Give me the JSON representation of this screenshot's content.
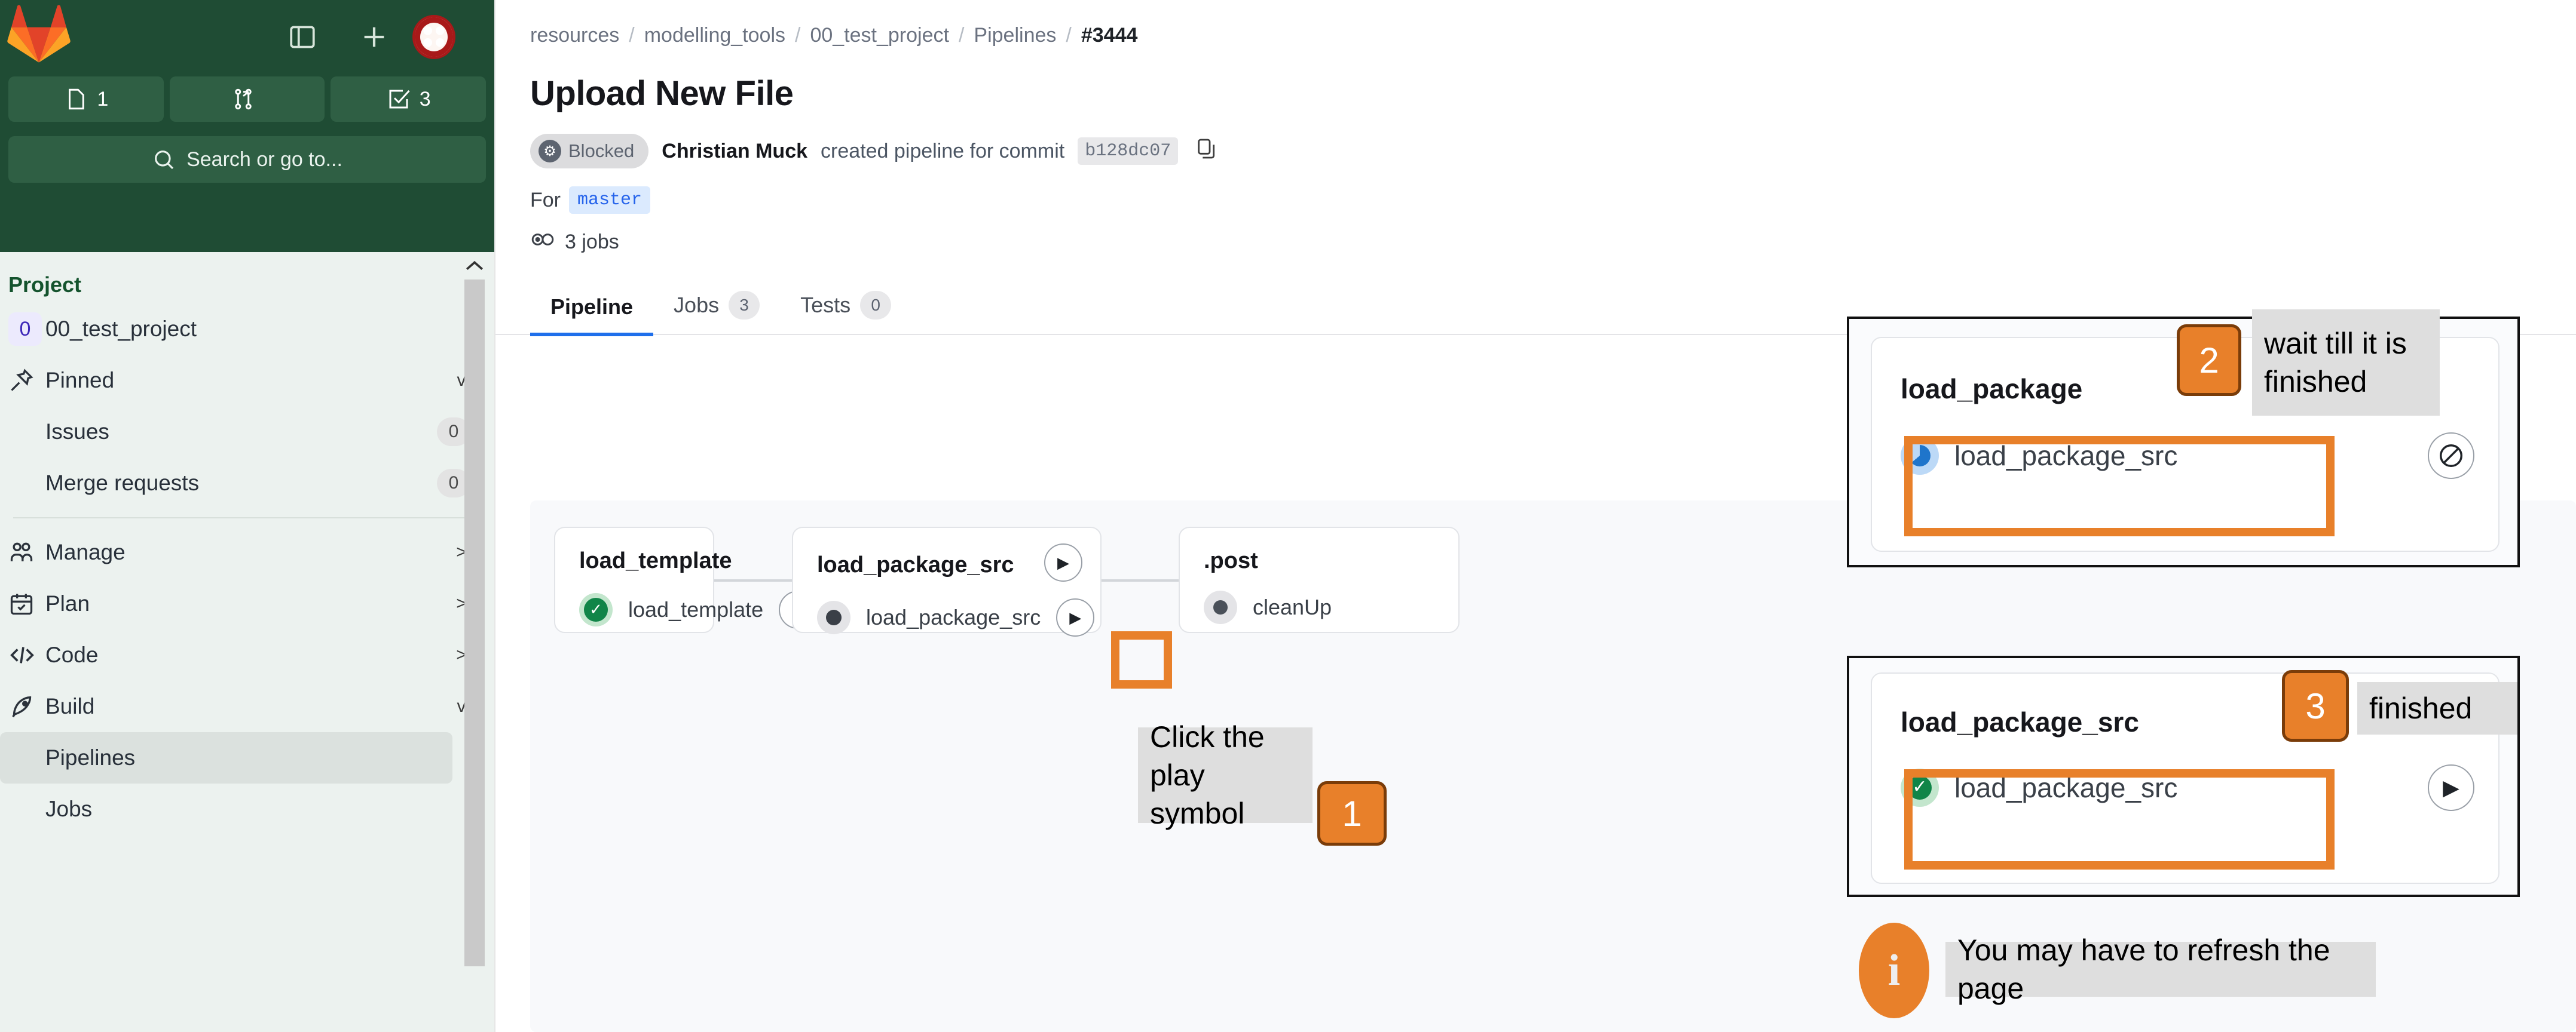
{
  "sidebar": {
    "header": {
      "logo_icon": "gitlab-logo-icon",
      "panel_toggle_icon": "sidebar-panel-icon",
      "new_icon": "plus-icon",
      "avatar_icon": "user-avatar"
    },
    "counters": [
      {
        "icon": "issue-icon",
        "value": "1"
      },
      {
        "icon": "merge-request-icon",
        "value": ""
      },
      {
        "icon": "todo-checkbox-icon",
        "value": "3"
      }
    ],
    "search_placeholder": "Search or go to...",
    "search_icon": "search-icon",
    "section_title": "Project",
    "items": [
      {
        "label": "00_test_project",
        "badge": "0",
        "type": "project",
        "count": "",
        "chevron": ""
      },
      {
        "label": "Pinned",
        "icon": "pin-icon",
        "count": "",
        "chevron": "v"
      },
      {
        "label": "Issues",
        "icon": "",
        "count": "0",
        "chevron": ""
      },
      {
        "label": "Merge requests",
        "icon": "",
        "count": "0",
        "chevron": ""
      },
      {
        "label": "Manage",
        "icon": "users-icon",
        "count": "",
        "chevron": ">"
      },
      {
        "label": "Plan",
        "icon": "calendar-icon",
        "count": "",
        "chevron": ">"
      },
      {
        "label": "Code",
        "icon": "code-brackets-icon",
        "count": "",
        "chevron": ">"
      },
      {
        "label": "Build",
        "icon": "rocket-icon",
        "count": "",
        "chevron": "v"
      },
      {
        "label": "Pipelines",
        "icon": "",
        "count": "",
        "chevron": "",
        "active": true
      },
      {
        "label": "Jobs",
        "icon": "",
        "count": "",
        "chevron": ""
      }
    ]
  },
  "main": {
    "breadcrumb": [
      "resources",
      "modelling_tools",
      "00_test_project",
      "Pipelines",
      "#3444"
    ],
    "page_title": "Upload New File",
    "status": {
      "badge_label": "Blocked",
      "badge_icon": "gear-icon",
      "author": "Christian Muck",
      "text_after_author": "created pipeline for commit",
      "commit_sha": "b128dc07",
      "copy_icon": "copy-to-clipboard-icon"
    },
    "for_row": {
      "label": "For",
      "branch": "master"
    },
    "jobs_row": {
      "icon": "jobs-icon",
      "label": "3 jobs"
    },
    "tabs": [
      {
        "label": "Pipeline",
        "count": "",
        "active": true
      },
      {
        "label": "Jobs",
        "count": "3",
        "active": false
      },
      {
        "label": "Tests",
        "count": "0",
        "active": false
      }
    ],
    "graph": {
      "stages": [
        {
          "title": "load_template",
          "header_action_icon": "",
          "jobs": [
            {
              "status": "success",
              "name": "load_template",
              "action_icon": "play-icon"
            }
          ]
        },
        {
          "title": "load_package_src",
          "header_action_icon": "play-icon",
          "jobs": [
            {
              "status": "manual",
              "name": "load_package_src",
              "action_icon": "play-icon",
              "highlighted": true
            }
          ]
        },
        {
          "title": ".post",
          "header_action_icon": "",
          "jobs": [
            {
              "status": "created",
              "name": "cleanUp",
              "action_icon": ""
            }
          ]
        }
      ]
    }
  },
  "annotations": {
    "callout_1": {
      "number": "1",
      "text": "Click the play\nsymbol"
    },
    "callout_2": {
      "number": "2",
      "text": "wait till it is\nfinished",
      "panel": {
        "stage_title": "load_package",
        "job_status": "running",
        "job_name": "load_package_src",
        "action_icon": "cancel-icon"
      }
    },
    "callout_3": {
      "number": "3",
      "text": "finished",
      "panel": {
        "stage_title": "load_package_src",
        "job_status": "success",
        "job_name": "load_package_src",
        "action_icon": "play-icon"
      }
    },
    "info_note": {
      "icon": "info-icon",
      "text": "You may have to refresh the page"
    }
  },
  "colors": {
    "gitlab_green": "#1f4c34",
    "accent_orange": "#e8802a",
    "success_green": "#108548",
    "running_blue": "#1f75cb",
    "tab_active_blue": "#1f6feb"
  }
}
